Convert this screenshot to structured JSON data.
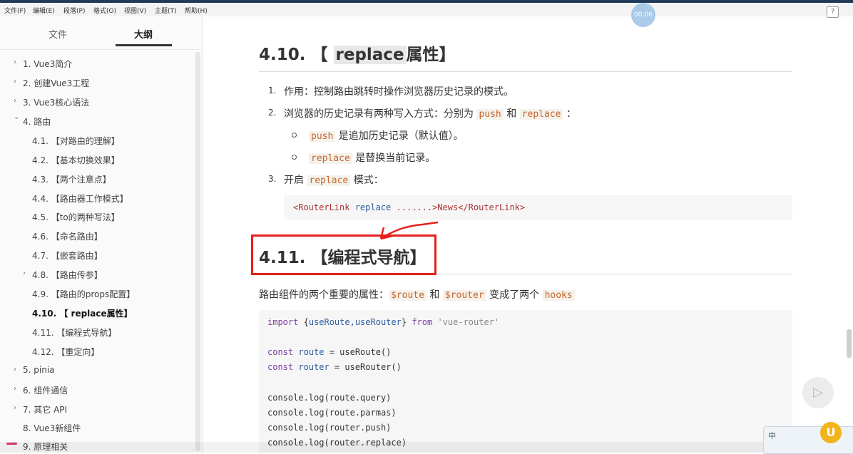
{
  "menubar": {
    "items": [
      "文件(F)",
      "编辑(E)",
      "段落(P)",
      "格式(O)",
      "视图(V)",
      "主题(T)",
      "帮助(H)"
    ],
    "help": "?",
    "timer": "00:06"
  },
  "sidebar": {
    "tabs": {
      "files": "文件",
      "outline": "大纲"
    },
    "items": [
      {
        "label": "1. Vue3简介",
        "caret": "›"
      },
      {
        "label": "2. 创建Vue3工程",
        "caret": "›"
      },
      {
        "label": "3. Vue3核心语法",
        "caret": "›"
      },
      {
        "label": "4. 路由",
        "caret": "⌄"
      },
      {
        "label": "4.1. 【对路由的理解】"
      },
      {
        "label": "4.2. 【基本切换效果】"
      },
      {
        "label": "4.3. 【两个注意点】"
      },
      {
        "label": "4.4. 【路由器工作模式】"
      },
      {
        "label": "4.5. 【to的两种写法】"
      },
      {
        "label": "4.6. 【命名路由】"
      },
      {
        "label": "4.7. 【嵌套路由】"
      },
      {
        "label": "4.8. 【路由传参】",
        "caret": "›"
      },
      {
        "label": "4.9. 【路由的props配置】"
      },
      {
        "label": "4.10. 【 replace属性】"
      },
      {
        "label": "4.11. 【编程式导航】"
      },
      {
        "label": "4.12. 【重定向】"
      },
      {
        "label": "5. pinia",
        "caret": "›"
      },
      {
        "label": "6. 组件通信",
        "caret": "›"
      },
      {
        "label": "7. 其它 API",
        "caret": "›"
      },
      {
        "label": "8. Vue3新组件",
        "caret": "›"
      },
      {
        "label": "9. 原理相关",
        "caret": "›"
      }
    ]
  },
  "content": {
    "h_replace": {
      "num": "4.10. 【 ",
      "hl": "replace",
      "rest": "属性】"
    },
    "item1": {
      "num": "1.",
      "text": "作用：控制路由跳转时操作浏览器历史记录的模式。"
    },
    "item2": {
      "num": "2.",
      "text_a": "浏览器的历史记录有两种写入方式：分别为 ",
      "code_a": "push",
      "text_b": " 和 ",
      "code_b": "replace",
      "text_c": " ："
    },
    "bullet1": {
      "code": "push",
      "text": " 是追加历史记录（默认值）。"
    },
    "bullet2": {
      "code": "replace",
      "text": " 是替换当前记录。"
    },
    "item3": {
      "num": "3.",
      "text_a": "开启 ",
      "code": "replace",
      "text_b": " 模式："
    },
    "code1": {
      "a": "<RouterLink ",
      "b": "replace",
      "c": " .......>News</RouterLink>"
    },
    "h_nav": "4.11. 【编程式导航】",
    "nav_para": {
      "text_a": "路由组件的两个重要的属性：",
      "code_a": "$route",
      "text_b": " 和 ",
      "code_b": "$router",
      "text_c": " 变成了两个 ",
      "code_c": "hooks"
    },
    "code2": {
      "line1_kw": "import",
      "line1_a": " {",
      "line1_fn": "useRoute,useRouter",
      "line1_b": "} ",
      "line1_kw2": "from",
      "line1_str": " 'vue-router'",
      "line2_kw": "const",
      "line2_var": " route",
      "line2_rest": " = useRoute()",
      "line3_kw": "const",
      "line3_var": " router",
      "line3_rest": " = useRouter()",
      "line4": "console.log(route.query)",
      "line5": "console.log(route.parmas)",
      "line6": "console.log(router.push)",
      "line7": "console.log(router.replace)"
    }
  },
  "ime": {
    "label": "中",
    "logo": "U"
  }
}
